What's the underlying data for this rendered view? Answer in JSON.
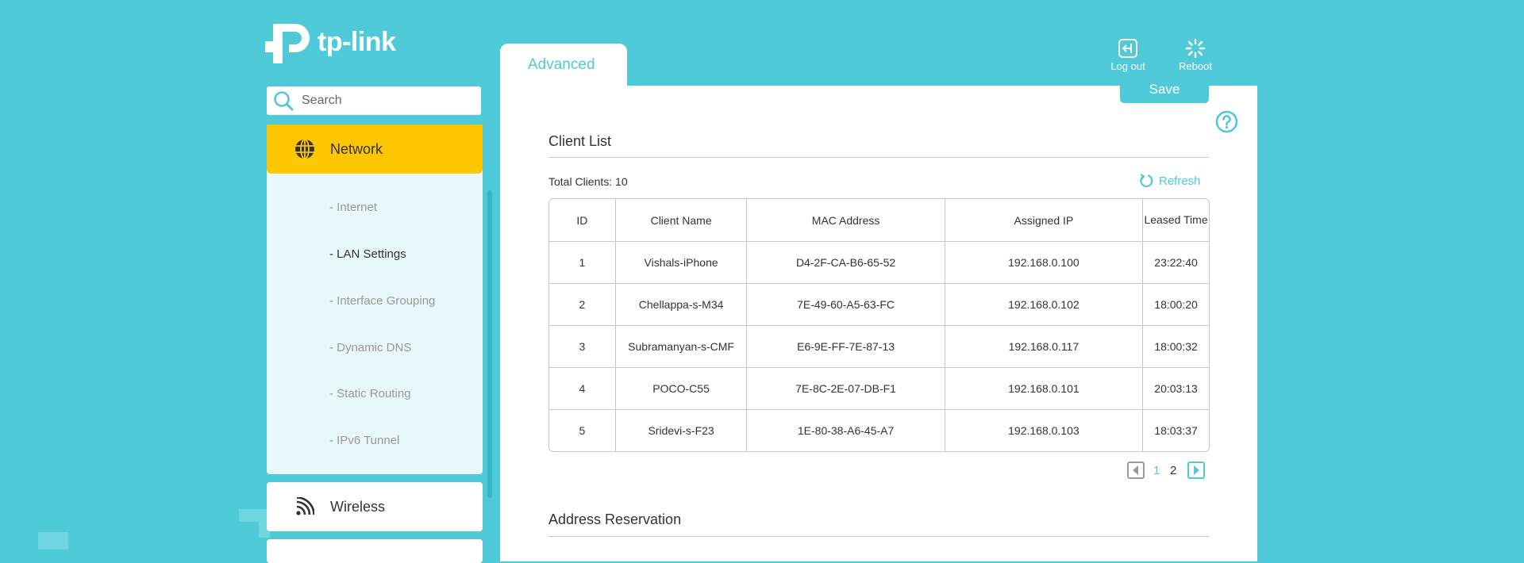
{
  "brand": {
    "logo_text": "tp-link"
  },
  "search": {
    "placeholder": "Search"
  },
  "sidebar": {
    "active_group": {
      "label": "Network"
    },
    "items": [
      {
        "label": "- Internet"
      },
      {
        "label": "- LAN Settings",
        "active": true
      },
      {
        "label": "- Interface Grouping"
      },
      {
        "label": "- Dynamic DNS"
      },
      {
        "label": "- Static Routing"
      },
      {
        "label": "- IPv6 Tunnel"
      }
    ],
    "wireless_label": "Wireless"
  },
  "header": {
    "tab_label": "Advanced",
    "logout_label": "Log out",
    "reboot_label": "Reboot",
    "save_label": "Save"
  },
  "client_list": {
    "title": "Client List",
    "total_label": "Total Clients: 10",
    "refresh_label": "Refresh",
    "columns": [
      "ID",
      "Client Name",
      "MAC Address",
      "Assigned IP",
      "Leased Time"
    ],
    "rows": [
      [
        "1",
        "Vishals-iPhone",
        "D4-2F-CA-B6-65-52",
        "192.168.0.100",
        "23:22:40"
      ],
      [
        "2",
        "Chellappa-s-M34",
        "7E-49-60-A5-63-FC",
        "192.168.0.102",
        "18:00:20"
      ],
      [
        "3",
        "Subramanyan-s-CMF",
        "E6-9E-FF-7E-87-13",
        "192.168.0.117",
        "18:00:32"
      ],
      [
        "4",
        "POCO-C55",
        "7E-8C-2E-07-DB-F1",
        "192.168.0.101",
        "20:03:13"
      ],
      [
        "5",
        "Sridevi-s-F23",
        "1E-80-38-A6-45-A7",
        "192.168.0.103",
        "18:03:37"
      ]
    ],
    "pagination": {
      "pages": [
        "1",
        "2"
      ],
      "current": "1"
    }
  },
  "address_reservation": {
    "title": "Address Reservation"
  },
  "colors": {
    "accent": "#4ecad8",
    "active_nav": "#fdc600"
  }
}
